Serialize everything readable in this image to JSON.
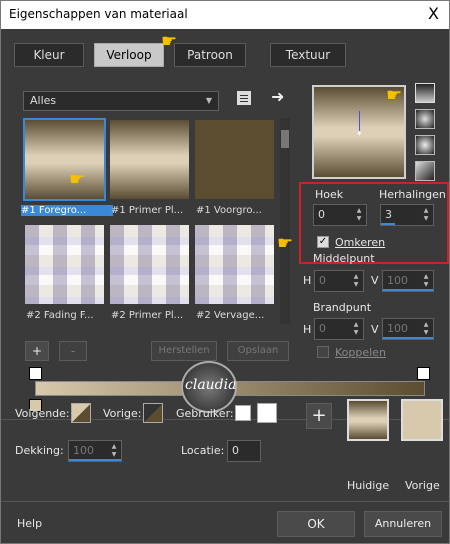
{
  "window": {
    "title": "Eigenschappen van materiaal",
    "close": "X"
  },
  "tabs": [
    "Kleur",
    "Verloop",
    "Patroon",
    "Textuur"
  ],
  "filter": {
    "selected": "Alles"
  },
  "thumbnails": [
    "#1 Foregro...",
    "#1 Primer Pl...",
    "#1 Voorgro...",
    "#2 Fading F...",
    "#2 Primer Pl...",
    "#2 Vervage..."
  ],
  "angle": {
    "label": "Hoek",
    "value": "0"
  },
  "repeats": {
    "label": "Herhalingen",
    "value": "3"
  },
  "invert": {
    "label": "Omkeren",
    "checked": true
  },
  "center": {
    "label": "Middelpunt",
    "h_label": "H",
    "h_value": "0",
    "v_label": "V",
    "v_value": "100"
  },
  "focal": {
    "label": "Brandpunt",
    "h_label": "H",
    "h_value": "0",
    "v_label": "V",
    "v_value": "100"
  },
  "link": {
    "label": "Koppelen"
  },
  "editor": {
    "add": "+",
    "remove": "-",
    "restore": "Herstellen",
    "save": "Opslaan"
  },
  "next": {
    "label": "Volgende:"
  },
  "prev": {
    "label": "Vorige:"
  },
  "user": {
    "label": "Gebruiker:"
  },
  "opacity": {
    "label": "Dekking:",
    "value": "100"
  },
  "location": {
    "label": "Locatie:",
    "value": "0"
  },
  "swatches": {
    "current": "Huidige",
    "previous": "Vorige"
  },
  "watermark": {
    "text": "claudia"
  },
  "footer": {
    "help": "Help",
    "ok": "OK",
    "cancel": "Annuleren"
  },
  "colors": {
    "dark_brown": "#5c4d31",
    "beige": "#d8c9ac",
    "accent": "#3a88d8",
    "highlight": "#d0202a"
  },
  "icons": [
    "save-preset-icon",
    "arrow-right-icon",
    "hand-pointer-icon",
    "dropdown-arrow-icon"
  ]
}
